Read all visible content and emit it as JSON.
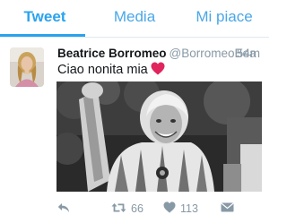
{
  "tabs": [
    {
      "label": "Tweet",
      "active": true
    },
    {
      "label": "Media",
      "active": false
    },
    {
      "label": "Mi piace",
      "active": false
    }
  ],
  "tweet": {
    "author_name": "Beatrice Borromeo",
    "author_handle": "@BorromeoBea",
    "time": "54m",
    "text": "Ciao nonita mia",
    "text_emoji": "heart-emoji",
    "retweet_count": "66",
    "like_count": "113",
    "icons": [
      "reply-icon",
      "retweet-icon",
      "like-icon",
      "direct-message-icon"
    ]
  },
  "colors": {
    "accent": "#2aa3ef",
    "text": "#14171a",
    "muted": "#8899a6",
    "heart": "#e0245e"
  }
}
